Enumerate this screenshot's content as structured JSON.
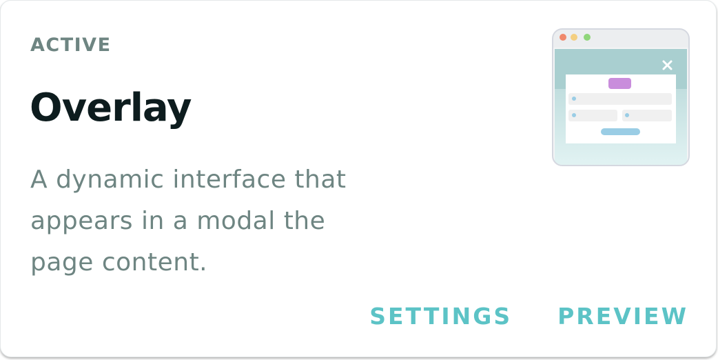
{
  "card": {
    "status": "ACTIVE",
    "title": "Overlay",
    "description": "A dynamic interface that appears in a modal the page content.",
    "thumbnail_icon": "overlay-modal-illustration-icon",
    "actions": [
      {
        "label": "SETTINGS"
      },
      {
        "label": "PREVIEW"
      }
    ]
  },
  "colors": {
    "status_text": "#6e8582",
    "title_text": "#0d1c1e",
    "accent": "#5cc3c6",
    "modal_button": "#c98ddc",
    "submit_bar": "#9acde5"
  }
}
